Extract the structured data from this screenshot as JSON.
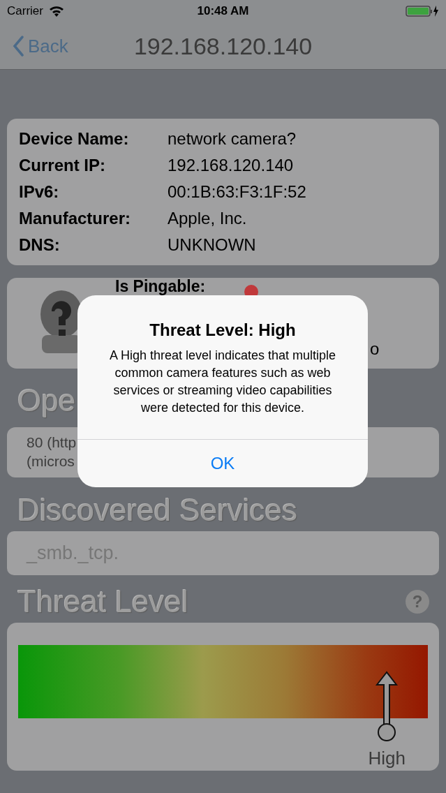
{
  "status_bar": {
    "carrier": "Carrier",
    "time": "10:48 AM"
  },
  "nav": {
    "back": "Back",
    "title": "192.168.120.140"
  },
  "device_info": [
    {
      "label": "Device Name:",
      "value": "network camera?"
    },
    {
      "label": "Current IP:",
      "value": "192.168.120.140"
    },
    {
      "label": "IPv6:",
      "value": "00:1B:63:F3:1F:52"
    },
    {
      "label": "Manufacturer:",
      "value": "Apple, Inc."
    },
    {
      "label": "DNS:",
      "value": "UNKNOWN"
    }
  ],
  "ping_card": {
    "label": "Is Pingable:",
    "fragment": "o"
  },
  "open_ports": {
    "heading": "Ope",
    "lines": [
      "80 (http",
      "(micros"
    ]
  },
  "discovered_services": {
    "heading": "Discovered Services",
    "items": [
      "_smb._tcp."
    ]
  },
  "threat_level": {
    "heading": "Threat Level",
    "help": "?",
    "level": 0.9,
    "label": "High"
  },
  "alert": {
    "title": "Threat Level: High",
    "message": "A High threat level indicates that multiple common camera features such as web services or streaming video capabilities were detected for this device.",
    "button": "OK"
  }
}
